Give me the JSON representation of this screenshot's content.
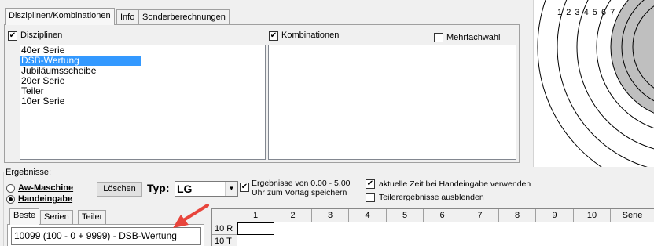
{
  "tabs": [
    {
      "label": "Disziplinen/Kombinationen",
      "active": true
    },
    {
      "label": "Info",
      "active": false
    },
    {
      "label": "Sonderberechnungen",
      "active": false
    }
  ],
  "disziplinen": {
    "checkbox_label": "Disziplinen",
    "checked": true,
    "items": [
      "40er Serie",
      "DSB-Wertung",
      "Jubiläumsscheibe",
      "20er Serie",
      "Teiler",
      "10er Serie"
    ],
    "selected": "DSB-Wertung"
  },
  "kombinationen": {
    "checkbox_label": "Kombinationen",
    "checked": true,
    "mehrfachwahl_label": "Mehrfachwahl",
    "mehrfachwahl_checked": false
  },
  "target": {
    "ring_numbers": [
      "1",
      "2",
      "3",
      "4",
      "5",
      "6",
      "7"
    ]
  },
  "ergebnisse": {
    "group_label": "Ergebnisse:",
    "radio_aw": "Aw-Maschine",
    "radio_hand": "Handeingabe",
    "selected_radio": "Handeingabe",
    "loeschen_label": "Löschen",
    "typ_label": "Typ:",
    "typ_value": "LG",
    "range_label": "Ergebnisse von 0.00 - 5.00",
    "range_label2": "Uhr zum Vortag speichern",
    "range_checked": true,
    "aktuelle_zeit_label": "aktuelle Zeit bei Handeingabe verwenden",
    "aktuelle_zeit_checked": true,
    "teiler_label": "Teilerergebnisse ausblenden",
    "teiler_checked": false
  },
  "subtabs": [
    {
      "label": "Beste",
      "active": true
    },
    {
      "label": "Serien",
      "active": false
    },
    {
      "label": "Teiler",
      "active": false
    }
  ],
  "result_value": "10099 (100 - 0 + 9999) - DSB-Wertung",
  "grid": {
    "columns": [
      "1",
      "2",
      "3",
      "4",
      "5",
      "6",
      "7",
      "8",
      "9",
      "10",
      "Serie"
    ],
    "rows": [
      "10 R",
      "10 T"
    ]
  },
  "colors": {
    "selection": "#3399ff",
    "arrow": "#e8453c",
    "ring_fill": "#bfbfbf"
  }
}
